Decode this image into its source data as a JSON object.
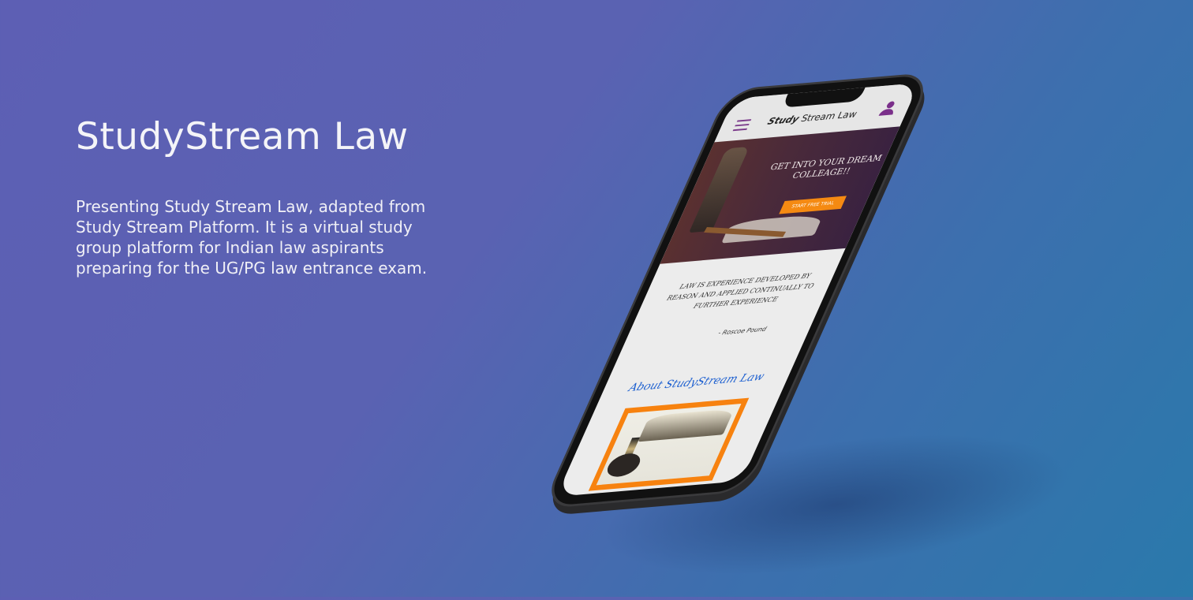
{
  "hero": {
    "title": "StudyStream Law",
    "description": "Presenting Study Stream Law, adapted from Study Stream Platform. It is a virtual study group platform for Indian law aspirants preparing for the UG/PG law entrance exam."
  },
  "app": {
    "brand_bold": "Study",
    "brand_rest": "Stream Law",
    "icons": {
      "menu": "hamburger-icon",
      "user": "user-icon"
    },
    "banner": {
      "headline": "GET INTO YOUR DREAM COLLEAGE!!",
      "cta": "START FREE TRIAL"
    },
    "quote": {
      "text": "LAW IS EXPERIENCE DEVELOPED BY REASON AND APPLIED CONTINUALLY TO FURTHER EXPERIENCE",
      "author": "- Roscoe Pound"
    },
    "about_heading": "About StudyStream Law",
    "colors": {
      "accent": "#f7820f",
      "link": "#1c5fd0",
      "brand": "#7a2f8a"
    }
  }
}
